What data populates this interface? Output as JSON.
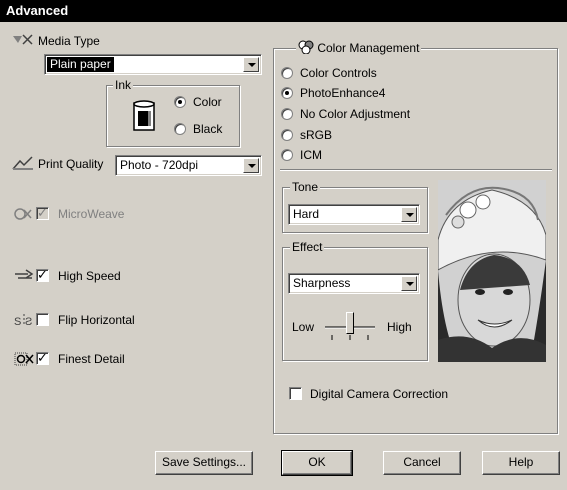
{
  "window": {
    "title": "Advanced"
  },
  "media_type": {
    "label": "Media Type",
    "value": "Plain paper"
  },
  "ink": {
    "label": "Ink",
    "options": [
      "Color",
      "Black"
    ],
    "selected": "Color"
  },
  "print_quality": {
    "label": "Print Quality",
    "value": "Photo - 720dpi"
  },
  "options": {
    "microweave": {
      "label": "MicroWeave",
      "checked": true,
      "enabled": false
    },
    "high_speed": {
      "label": "High Speed",
      "checked": true
    },
    "flip_horizontal": {
      "label": "Flip Horizontal",
      "checked": false
    },
    "finest_detail": {
      "label": "Finest Detail",
      "checked": true
    }
  },
  "color_management": {
    "label": "Color Management",
    "options": [
      "Color Controls",
      "PhotoEnhance4",
      "No Color Adjustment",
      "sRGB",
      "ICM"
    ],
    "selected": "PhotoEnhance4"
  },
  "tone": {
    "label": "Tone",
    "value": "Hard"
  },
  "effect": {
    "label": "Effect",
    "value": "Sharpness",
    "slider_low": "Low",
    "slider_high": "High",
    "level": 0.5
  },
  "digital_camera_correction": {
    "label": "Digital Camera Correction",
    "checked": false
  },
  "buttons": {
    "save_settings": "Save Settings...",
    "ok": "OK",
    "cancel": "Cancel",
    "help": "Help"
  },
  "colors": {
    "titlebar": "#000000",
    "face": "#d4d0c8"
  }
}
